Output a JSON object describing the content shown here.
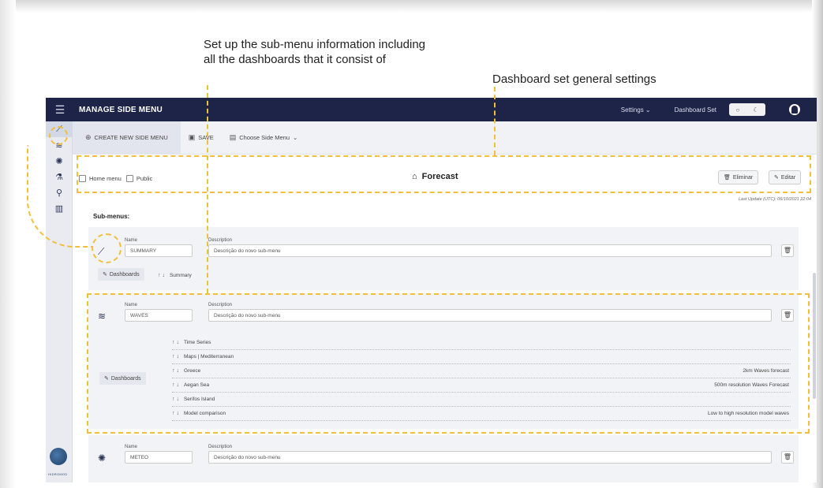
{
  "annotations": {
    "submenu_callout": "Set up the sub-menu information including all the dashboards that it consist of",
    "general_callout": "Dashboard set general settings",
    "highlight_color": "#f2bf3a"
  },
  "topbar": {
    "title": "MANAGE SIDE MENU",
    "settings_label": "Settings",
    "dashboard_set_label": "Dashboard Set",
    "bg_color": "#1d2447"
  },
  "sidebar": {
    "icons": [
      "chart-line-icon",
      "wave-icon",
      "wind-icon",
      "flask-icon",
      "microscope-icon",
      "library-icon"
    ],
    "logo_text": "HIDROMOD"
  },
  "toolbar": {
    "create_label": "CREATE NEW SIDE MENU",
    "save_label": "SAVE",
    "choose_label": "Choose Side Menu"
  },
  "header": {
    "home_menu_label": "Home menu",
    "public_label": "Public",
    "title": "Forecast",
    "delete_label": "Eliminar",
    "edit_label": "Editar",
    "last_update": "Last Update (UTC): 06/10/2021 22:04"
  },
  "submenus_title": "Sub-menus:",
  "submenus": [
    {
      "name_label": "Name",
      "name": "SUMMARY",
      "description_label": "Description",
      "description": "Descrição do novo sub-menu",
      "dashboards_label": "Dashboards",
      "dashboards": [
        {
          "name": "Summary",
          "desc": ""
        }
      ]
    },
    {
      "name_label": "Name",
      "name": "WAVES",
      "description_label": "Description",
      "description": "Descrição do novo sub-menu",
      "dashboards_label": "Dashboards",
      "dashboards": [
        {
          "name": "Time Series",
          "desc": ""
        },
        {
          "name": "Maps | Mediterranean",
          "desc": ""
        },
        {
          "name": "Greece",
          "desc": "2km Waves forecast"
        },
        {
          "name": "Aegan Sea",
          "desc": "500m resolution Waves Forecast"
        },
        {
          "name": "Serifos Island",
          "desc": ""
        },
        {
          "name": "Model comparison",
          "desc": "Low to high resolution model waves"
        }
      ]
    },
    {
      "name_label": "Name",
      "name": "METEO",
      "description_label": "Description",
      "description": "Descrição do novo sub-menu"
    }
  ]
}
